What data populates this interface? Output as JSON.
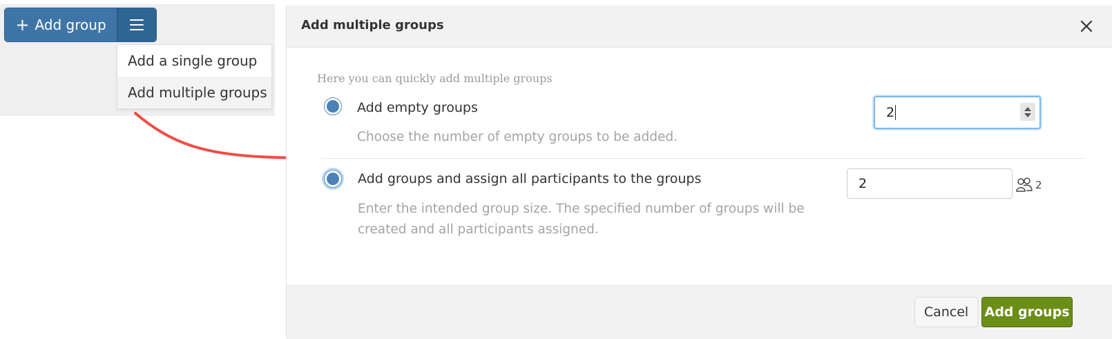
{
  "toolbar": {
    "add_group_label": "Add group",
    "add_group_icon": "plus-icon",
    "menu_icon": "hamburger-icon"
  },
  "dropdown": {
    "items": [
      {
        "label": "Add a single group",
        "active": false
      },
      {
        "label": "Add multiple groups",
        "active": true
      }
    ]
  },
  "modal": {
    "title": "Add multiple groups",
    "close_icon": "close-icon",
    "intro": "Here you can quickly add multiple groups",
    "options": [
      {
        "label": "Add empty groups",
        "help": "Choose the number of empty groups to be added.",
        "value": "2"
      },
      {
        "label": "Add groups and assign all participants to the groups",
        "help": "Enter the intended group size. The specified number of groups will be created and all participants assigned.",
        "value": "2",
        "resulting_group_count": "2",
        "group_icon": "group-icon"
      }
    ],
    "cancel_label": "Cancel",
    "submit_label": "Add groups"
  },
  "colors": {
    "primary_blue": "#3f75a6",
    "submit_green": "#6b8e17",
    "arrow_red": "#f24b47",
    "focus_ring": "#7fb7e6"
  }
}
